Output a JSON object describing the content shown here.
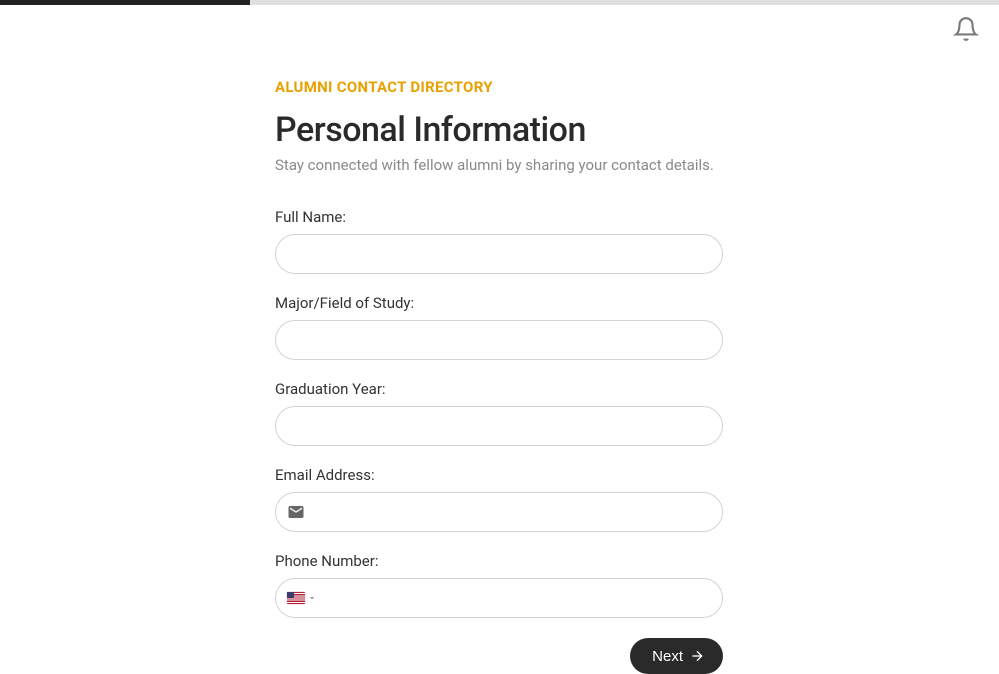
{
  "header": {
    "notifications_aria": "Notifications"
  },
  "form": {
    "eyebrow": "ALUMNI CONTACT DIRECTORY",
    "title": "Personal Information",
    "subtitle": "Stay connected with fellow alumni by sharing your contact details.",
    "fields": {
      "full_name": {
        "label": "Full Name:",
        "value": "",
        "placeholder": ""
      },
      "major": {
        "label": "Major/Field of Study:",
        "value": "",
        "placeholder": ""
      },
      "grad_year": {
        "label": "Graduation Year:",
        "value": "",
        "placeholder": ""
      },
      "email": {
        "label": "Email Address:",
        "value": "",
        "placeholder": ""
      },
      "phone": {
        "label": "Phone Number:",
        "value": "",
        "placeholder": "",
        "country": "US"
      }
    },
    "next_label": "Next"
  },
  "progress": {
    "percent": 25
  },
  "colors": {
    "accent": "#e8a100",
    "button": "#2a2a2a"
  }
}
